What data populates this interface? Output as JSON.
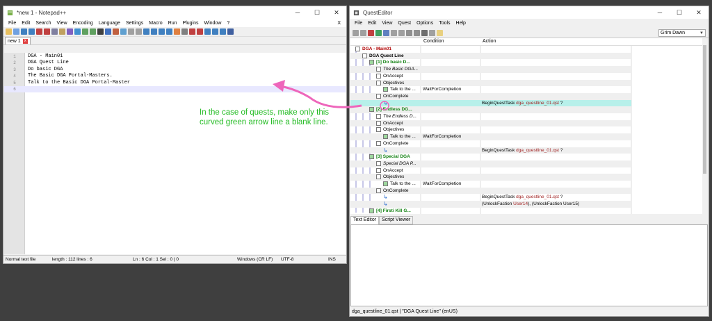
{
  "npp": {
    "title": "*new 1 - Notepad++",
    "menu": [
      "File",
      "Edit",
      "Search",
      "View",
      "Encoding",
      "Language",
      "Settings",
      "Macro",
      "Run",
      "Plugins",
      "Window",
      "?"
    ],
    "close_x": "X",
    "tab_label": "new 1",
    "tab_close": "x",
    "lines": [
      {
        "n": "1",
        "text": "DGA - Main01"
      },
      {
        "n": "2",
        "text": "DGA Quest Line"
      },
      {
        "n": "3",
        "text": "Do basic DGA"
      },
      {
        "n": "4",
        "text": "The Basic DGA Portal-Masters."
      },
      {
        "n": "5",
        "text": "Talk to the Basic DGA Portal-Master"
      },
      {
        "n": "6",
        "text": ""
      }
    ],
    "status": {
      "type": "Normal text file",
      "length": "length : 112    lines : 6",
      "pos": "Ln : 6    Col : 1    Sel : 0 | 0",
      "eol": "Windows (CR LF)",
      "enc": "UTF-8",
      "mode": "INS"
    }
  },
  "qe": {
    "title": "QuestEditor",
    "menu": [
      "File",
      "Edit",
      "View",
      "Quest",
      "Options",
      "Tools",
      "Help"
    ],
    "game_select": "Grim Dawn",
    "columns": {
      "condition": "Condition",
      "action": "Action"
    },
    "rows": [
      {
        "label": "DGA - Main01",
        "cls": "red",
        "indent": 3
      },
      {
        "label": "DGA Quest Line",
        "cls": "bold",
        "indent": 13
      },
      {
        "label": "[1] Do basic D...",
        "cls": "green",
        "indent": 23
      },
      {
        "label": "The Basic DGA...",
        "cls": "ital",
        "indent": 33
      },
      {
        "label": "OnAccept",
        "cls": "",
        "indent": 33
      },
      {
        "label": "Objectives",
        "cls": "",
        "indent": 33
      },
      {
        "label": "Talk to the ...",
        "cls": "",
        "indent": 43,
        "cond": "WaitForCompletion"
      },
      {
        "label": "OnComplete",
        "cls": "",
        "indent": 33
      },
      {
        "label": "",
        "cls": "",
        "indent": 43,
        "act_pre": "BeginQuestTask ",
        "act_hl": "dga_questline_01.qst",
        "act_post": " ?"
      },
      {
        "label": "[2] Endless DG...",
        "cls": "green",
        "indent": 23
      },
      {
        "label": "The Endless D...",
        "cls": "ital",
        "indent": 33
      },
      {
        "label": "OnAccept",
        "cls": "",
        "indent": 33
      },
      {
        "label": "Objectives",
        "cls": "",
        "indent": 33
      },
      {
        "label": "Talk to the ...",
        "cls": "",
        "indent": 43,
        "cond": "WaitForCompletion"
      },
      {
        "label": "OnComplete",
        "cls": "",
        "indent": 33
      },
      {
        "label": "",
        "cls": "",
        "indent": 43,
        "act_pre": "BeginQuestTask ",
        "act_hl": "dga_questline_01.qst",
        "act_post": " ?"
      },
      {
        "label": "[3] Special DGA",
        "cls": "green",
        "indent": 23
      },
      {
        "label": "Special DGA P...",
        "cls": "ital",
        "indent": 33
      },
      {
        "label": "OnAccept",
        "cls": "",
        "indent": 33
      },
      {
        "label": "Objectives",
        "cls": "",
        "indent": 33
      },
      {
        "label": "Talk to the ...",
        "cls": "",
        "indent": 43,
        "cond": "WaitForCompletion"
      },
      {
        "label": "OnComplete",
        "cls": "",
        "indent": 33
      },
      {
        "label": "",
        "cls": "",
        "indent": 43,
        "act_pre": "BeginQuestTask ",
        "act_hl": "dga_questline_01.qst",
        "act_post": " ?"
      },
      {
        "label": "",
        "cls": "",
        "indent": 43,
        "act_pre": "(UnlockFaction ",
        "act_hl": "User14",
        "act_post": "), (UnlockFaction User15)"
      },
      {
        "label": "[4] Firsti Kill G...",
        "cls": "green",
        "indent": 23
      }
    ],
    "bottom_tabs": [
      "Text Editor",
      "Script Viewer"
    ],
    "status": "dga_questline_01.qst | \"DGA Quest Line\" (enUS)"
  },
  "annotation": "In the case of quests, make only this curved green arrow line a blank line.",
  "colors": {
    "annotation_text": "#22bb22",
    "arrow": "#ee66bb",
    "selected_row": "#b7f0ea"
  }
}
